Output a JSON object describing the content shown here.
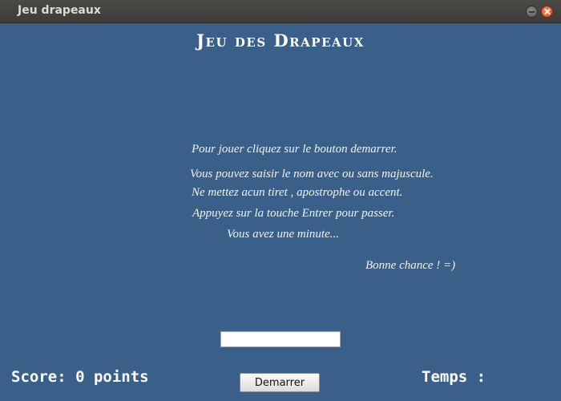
{
  "window": {
    "title": "Jeu drapeaux"
  },
  "icons": {
    "minimize": "minimize-icon",
    "close": "close-icon"
  },
  "colors": {
    "background": "#3a6089",
    "titlebar": "#3c3b37",
    "close_button": "#e0561f"
  },
  "heading": "Jeu des Drapeaux",
  "instructions": {
    "line1": "Pour jouer cliquez sur le bouton demarrer.",
    "line2": "Vous pouvez saisir le nom avec ou sans majuscule.",
    "line3": "Ne mettez acun tiret , apostrophe ou accent.",
    "line4": "Appuyez sur la touche Entrer pour passer.",
    "line5": "Vous avez une minute...",
    "line6": "Bonne chance !  =)"
  },
  "answer_input": {
    "value": ""
  },
  "score_text": "Score: 0 points",
  "start_button": "Demarrer",
  "timer_text": "Temps :"
}
